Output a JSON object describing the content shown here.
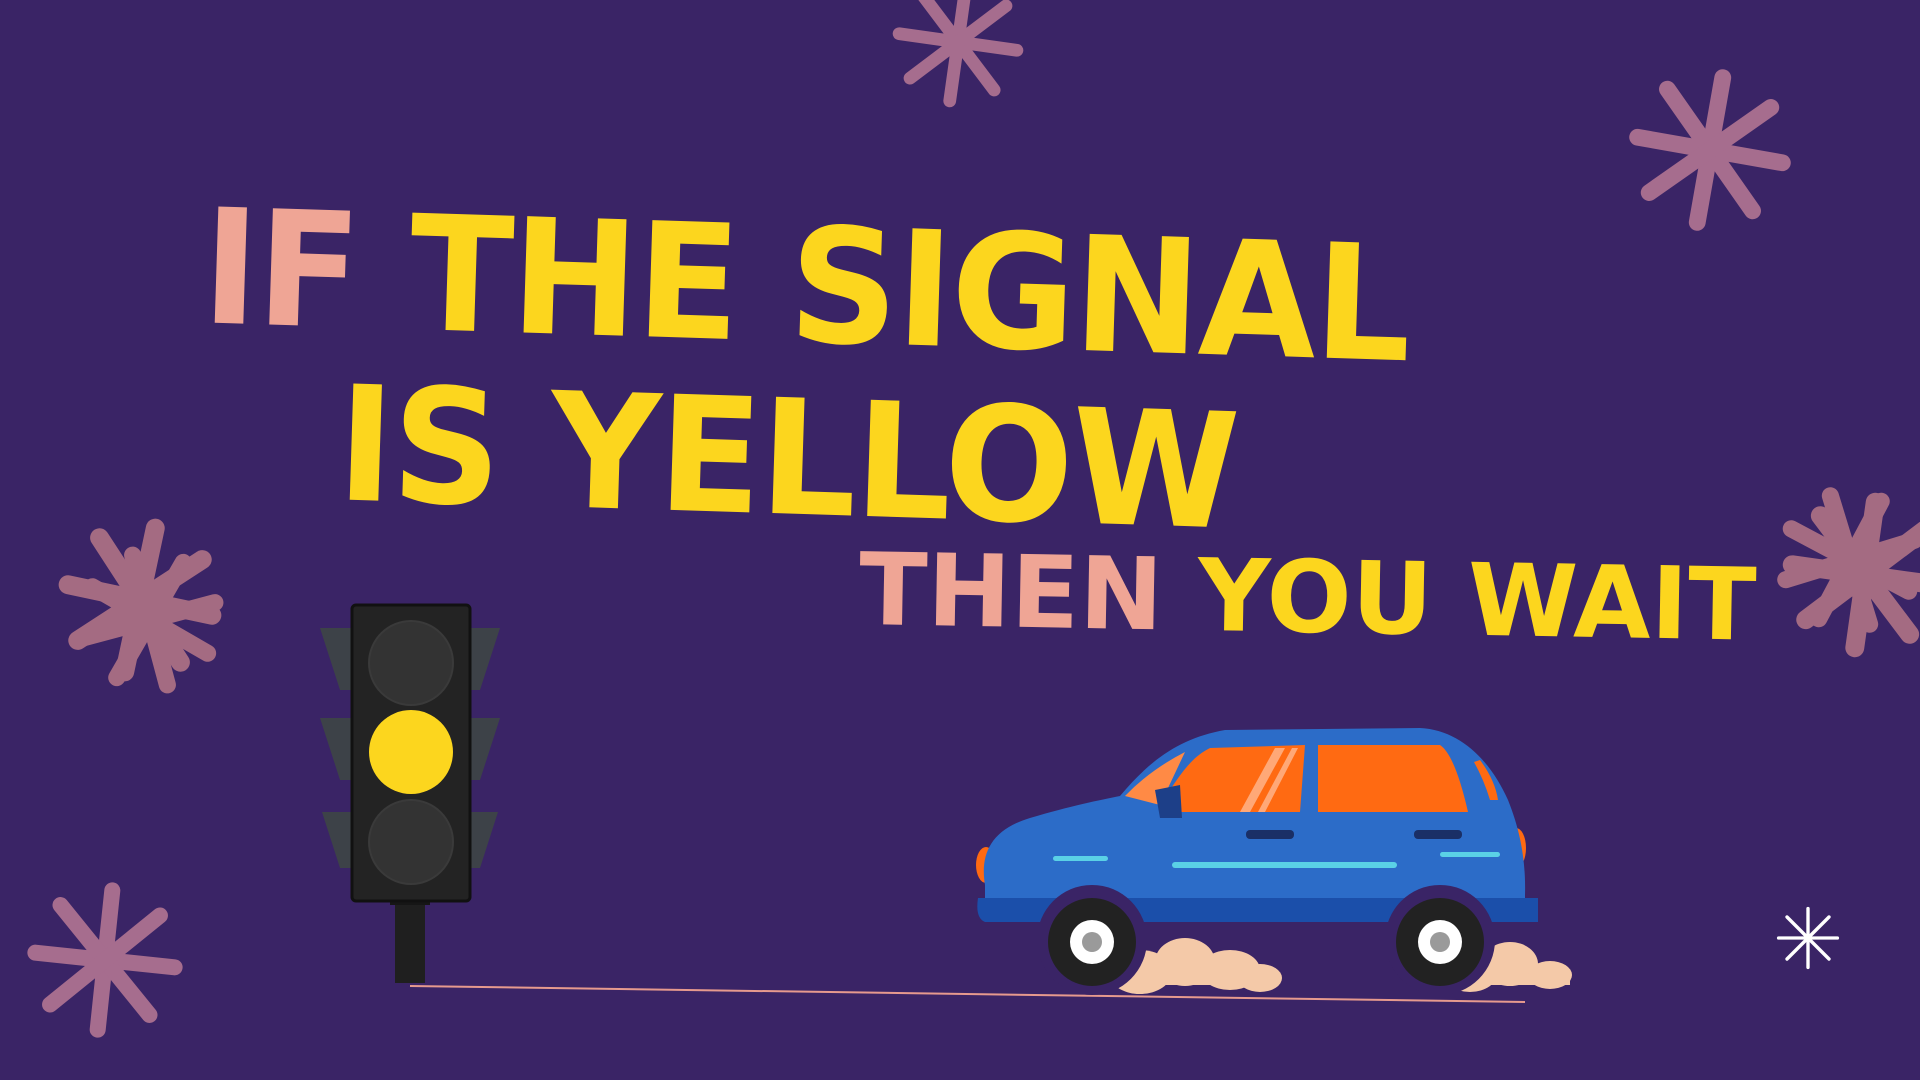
{
  "headline": {
    "line1": {
      "part1": "IF",
      "part2": "THE SIGNAL"
    },
    "line2": "IS YELLOW",
    "line3": {
      "part1": "THEN",
      "part2": "YOU WAIT"
    }
  },
  "colors": {
    "background": "#3a2466",
    "accent_yellow": "#fcd61e",
    "accent_pink": "#efa595",
    "sparkle": "#b97a95",
    "car_body": "#2c6cc8",
    "car_window": "#ff6a12",
    "traffic_light_housing": "#232323",
    "active_lamp": "#fcd61e"
  },
  "traffic_light": {
    "active_lamp": "yellow",
    "lamps": [
      "off",
      "yellow",
      "off"
    ]
  },
  "icons": [
    "sparkle-icon",
    "traffic-light-icon",
    "car-icon",
    "dust-cloud-icon"
  ]
}
